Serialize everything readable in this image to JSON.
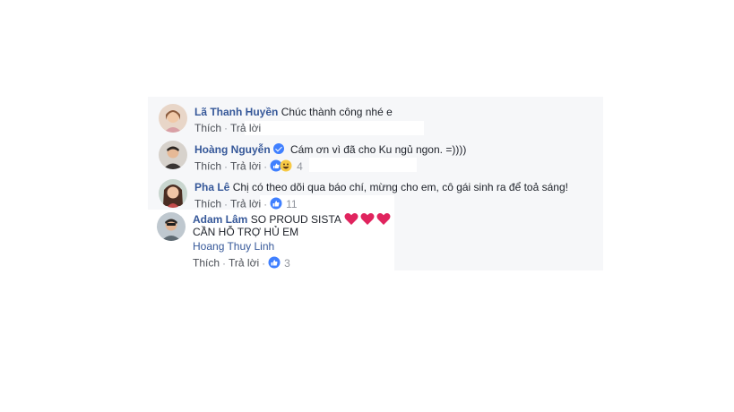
{
  "comments": [
    {
      "author": "Lã Thanh Huyền",
      "text": "Chúc thành công nhé e",
      "like": "Thích",
      "reply": "Trả lời",
      "reaction_count": ""
    },
    {
      "author": "Hoàng Nguyễn",
      "text": "Cám ơn vì đã cho Ku ngủ ngon. =))))",
      "like": "Thích",
      "reply": "Trả lời",
      "reaction_count": "4"
    },
    {
      "author": "Pha Lê",
      "text": "Chị có theo dõi qua báo chí, mừng cho em, cô gái sinh ra để toả sáng!",
      "like": "Thích",
      "reply": "Trả lời",
      "reaction_count": "11"
    },
    {
      "author": "Adam Lâm",
      "text": "SO PROUD SISTA",
      "text_line2": "CẦN HỖ TRỢ HỦ EM",
      "mention": "Hoang Thuy Linh",
      "like": "Thích",
      "reply": "Trả lời",
      "reaction_count": "3"
    }
  ],
  "separator": "·",
  "colors": {
    "author": "#365899",
    "background": "#f6f7f9",
    "like_blue": "#4080ff",
    "heart": "#e0245e"
  }
}
